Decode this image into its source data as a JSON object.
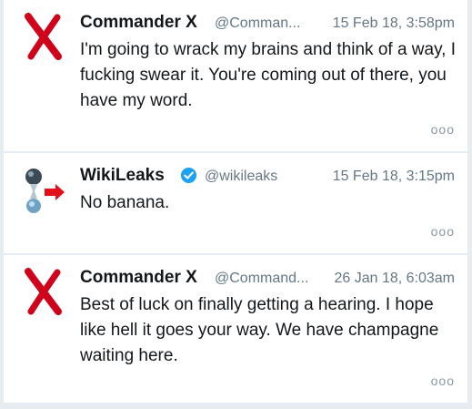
{
  "tweets": [
    {
      "name": "Commander X",
      "handle": "@Comman...",
      "timestamp": "15 Feb 18, 3:58pm",
      "text": "I'm going to wrack my brains and think of a way, I fucking swear it. You're coming out of there, you have my word.",
      "avatar_icon": "red-x-icon",
      "verified": false
    },
    {
      "name": "WikiLeaks",
      "handle": "@wikileaks",
      "timestamp": "15 Feb 18, 3:15pm",
      "text": "No banana.",
      "avatar_icon": "wikileaks-hourglass-icon",
      "verified": true
    },
    {
      "name": "Commander X",
      "handle": "@Command...",
      "timestamp": "26 Jan 18, 6:03am",
      "text": "Best of luck on finally getting a hearing. I hope like hell it goes your way. We have champagne waiting here.",
      "avatar_icon": "red-x-icon",
      "verified": false
    }
  ],
  "more_label": "ooo",
  "colors": {
    "background": "#e6ecf0",
    "card": "#ffffff",
    "text": "#14171a",
    "secondary": "#657786",
    "verified_blue": "#1da1f2",
    "red_x": "#d0021b"
  }
}
